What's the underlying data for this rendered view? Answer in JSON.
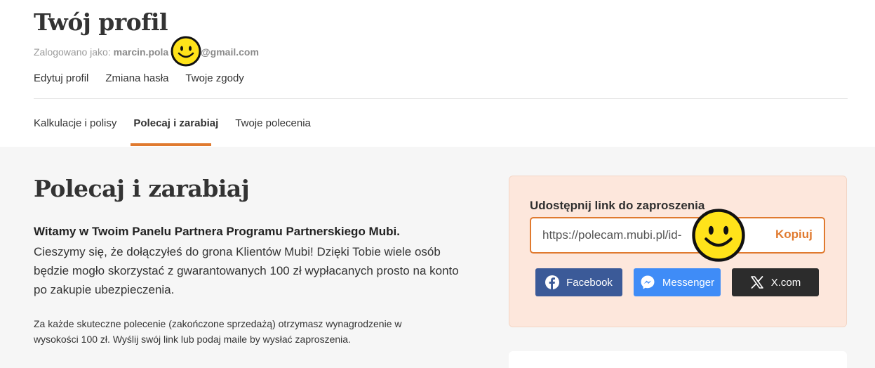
{
  "header": {
    "title": "Twój profil",
    "logged_prefix": "Zalogowano jako:",
    "email_visible_start": "marcin.pola",
    "email_visible_end": "@gmail.com"
  },
  "profile_links": [
    "Edytuj profil",
    "Zmiana hasła",
    "Twoje zgody"
  ],
  "tabs": [
    {
      "label": "Kalkulacje i polisy",
      "active": false
    },
    {
      "label": "Polecaj i zarabiaj",
      "active": true
    },
    {
      "label": "Twoje polecenia",
      "active": false
    }
  ],
  "main": {
    "title": "Polecaj i zarabiaj",
    "welcome_bold": "Witamy w Twoim Panelu Partnera Programu Partnerskiego Mubi.",
    "welcome_body": "Cieszymy się, że dołączyłeś do grona Klientów Mubi! Dzięki Tobie wiele osób będzie mogło skorzystać z gwarantowanych 100 zł wypłacanych prosto na konto po zakupie ubezpieczenia.",
    "note": "Za każde skuteczne polecenie (zakończone sprzedażą) otrzymasz wynagrodzenie w wysokości 100 zł. Wyślij swój link lub podaj maile by wysłać zaproszenia."
  },
  "share": {
    "label": "Udostępnij link do zaproszenia",
    "link_value": "https://polecam.mubi.pl/id-",
    "copy_label": "Kopiuj",
    "buttons": [
      {
        "label": "Facebook",
        "icon": "facebook-icon",
        "color": "#3b5a98"
      },
      {
        "label": "Messenger",
        "icon": "messenger-icon",
        "color": "#3f8cf7"
      },
      {
        "label": "X.com",
        "icon": "x-icon",
        "color": "#2c2c2c"
      }
    ]
  },
  "colors": {
    "accent": "#e07a2f",
    "share_card_bg": "#fde7dc",
    "page_bg_lower": "#f6f6f6"
  }
}
